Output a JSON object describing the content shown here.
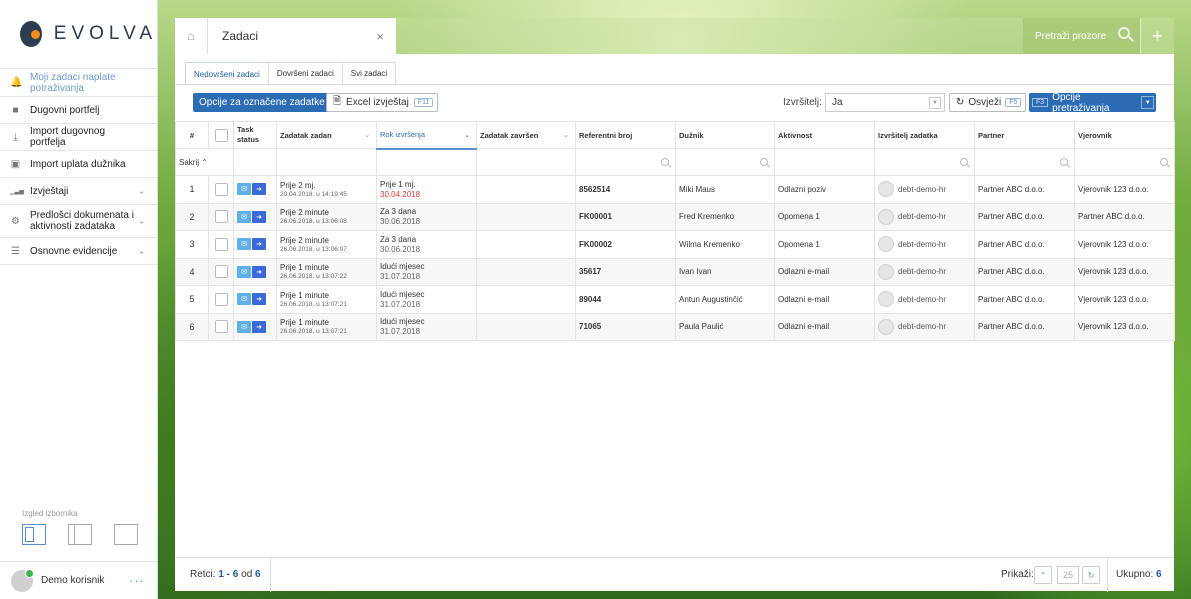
{
  "brand": {
    "name": "EVOLVA"
  },
  "sidebar": {
    "items": [
      {
        "label": "Moji zadaci naplate potraživanja",
        "icon": "bell-icon",
        "active": true
      },
      {
        "label": "Dugovni portfelj",
        "icon": "briefcase-icon"
      },
      {
        "label": "Import dugovnog portfelja",
        "icon": "download-icon"
      },
      {
        "label": "Import uplata dužnika",
        "icon": "money-icon"
      },
      {
        "label": "Izvještaji",
        "icon": "bar-chart-icon",
        "expandable": true
      },
      {
        "label": "Predlošci dokumenata i aktivnosti zadataka",
        "icon": "gear-icon",
        "expandable": true
      },
      {
        "label": "Osnovne evidencije",
        "icon": "list-icon",
        "expandable": true
      }
    ],
    "layout_label": "Izgled izbornika",
    "user": {
      "name": "Demo korisnik",
      "more": "···"
    }
  },
  "topbar": {
    "home_icon": "home-icon",
    "tab_title": "Zadaci",
    "close": "×",
    "search_placeholder": "Pretraži prozore",
    "add": "+"
  },
  "tabs": [
    "Nedovršeni zadaci",
    "Dovršeni zadaci",
    "Svi zadaci"
  ],
  "toolbar": {
    "options_button": "Opcije za označene zadatke",
    "excel_button": "Excel izvještaj",
    "excel_key": "F11",
    "assignee_label": "Izvršitelj:",
    "assignee_value": "Ja",
    "refresh_button": "Osvježi",
    "refresh_key": "F5",
    "search_key": "F3",
    "search_options_button": "Opcije pretraživanja"
  },
  "grid": {
    "columns": [
      "#",
      "",
      "Task status",
      "Zadatak zadan",
      "Rok izvršenja",
      "Zadatak završen",
      "Referentni broj",
      "Dužnik",
      "Aktivnost",
      "Izvršitelj zadatka",
      "Partner",
      "Vjerovnik"
    ],
    "hide_label": "Sakrij",
    "rows": [
      {
        "n": "1",
        "assigned": "Prije 2 mj.",
        "assigned_date": "20.04.2018.  u  14:19:45",
        "due": "Prije 1 mj.",
        "due_date": "30.04.2018",
        "overdue": true,
        "ref": "8562514",
        "debtor": "Miki Maus",
        "activity": "Odlazni poziv",
        "assignee": "debt-demo-hr",
        "partner": "Partner ABC d.o.o.",
        "creditor": "Vjerovnik 123 d.o.o."
      },
      {
        "n": "2",
        "assigned": "Prije 2 minute",
        "assigned_date": "26.06.2018.  u  13:06:08",
        "due": "Za 3 dana",
        "due_date": "30.06.2018",
        "ref": "FK00001",
        "debtor": "Fred Kremenko",
        "activity": "Opomena 1",
        "assignee": "debt-demo-hr",
        "partner": "Partner ABC d.o.o.",
        "creditor": "Partner ABC d.o.o."
      },
      {
        "n": "3",
        "assigned": "Prije 2 minute",
        "assigned_date": "26.06.2018.  u  13:06:07",
        "due": "Za 3 dana",
        "due_date": "30.06.2018",
        "ref": "FK00002",
        "debtor": "Wilma Kremenko",
        "activity": "Opomena 1",
        "assignee": "debt-demo-hr",
        "partner": "Partner ABC d.o.o.",
        "creditor": "Vjerovnik 123 d.o.o."
      },
      {
        "n": "4",
        "assigned": "Prije 1 minute",
        "assigned_date": "26.06.2018.  u  13:07:22",
        "due": "Idući mjesec",
        "due_date": "31.07.2018",
        "ref": "35617",
        "debtor": "Ivan Ivan",
        "activity": "Odlazni e-mail",
        "assignee": "debt-demo-hr",
        "partner": "Partner ABC d.o.o.",
        "creditor": "Vjerovnik 123 d.o.o."
      },
      {
        "n": "5",
        "assigned": "Prije 1 minute",
        "assigned_date": "26.06.2018.  u  13:07:21",
        "due": "Idući mjesec",
        "due_date": "31.07.2018",
        "ref": "89044",
        "debtor": "Antun Augustinčić",
        "activity": "Odlazni e-mail",
        "assignee": "debt-demo-hr",
        "partner": "Partner ABC d.o.o.",
        "creditor": "Vjerovnik 123 d.o.o."
      },
      {
        "n": "6",
        "assigned": "Prije 1 minute",
        "assigned_date": "26.06.2018.  u  13:07:21",
        "due": "Idući mjesec",
        "due_date": "31.07.2018",
        "ref": "71065",
        "debtor": "Paula Paulić",
        "activity": "Odlazni e-mail",
        "assignee": "debt-demo-hr",
        "partner": "Partner ABC d.o.o.",
        "creditor": "Vjerovnik 123 d.o.o."
      }
    ]
  },
  "footer": {
    "rows_label": "Retci:",
    "rows_range": "1 - 6",
    "rows_of": "od",
    "rows_total": "6",
    "show_label": "Prikaži:",
    "page_size": "25",
    "total_label": "Ukupno:",
    "total": "6"
  }
}
